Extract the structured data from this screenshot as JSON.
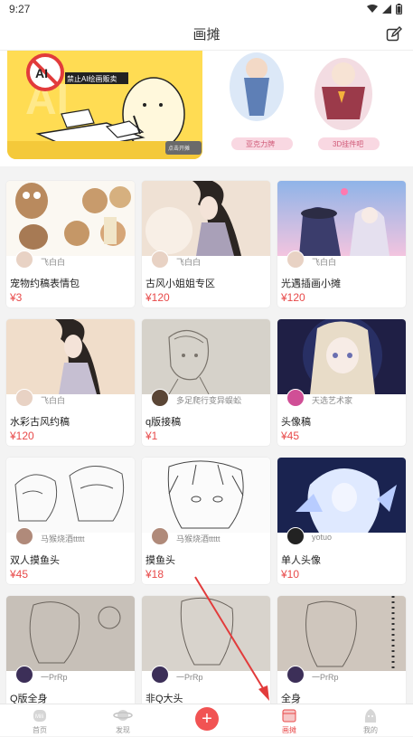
{
  "status_bar": {
    "time": "9:27"
  },
  "header": {
    "title": "画摊"
  },
  "banner": {
    "left": {
      "notice": "禁止AI绘画贩卖",
      "small_tag": "点击开摊"
    },
    "right": {
      "tag1": "亚克力牌",
      "tag2": "3D挂件吧"
    }
  },
  "cards": [
    {
      "title": "宠物约稿表情包",
      "price": "¥3",
      "author": "飞白白"
    },
    {
      "title": "古风小姐姐专区",
      "price": "¥120",
      "author": "飞白白"
    },
    {
      "title": "光遇插画小摊",
      "price": "¥120",
      "author": "飞白白"
    },
    {
      "title": "水彩古风约稿",
      "price": "¥120",
      "author": "飞白白"
    },
    {
      "title": "q版接稿",
      "price": "¥1",
      "author": "多足爬行变异蜈蚣"
    },
    {
      "title": "头像稿",
      "price": "¥45",
      "author": "天选艺术家"
    },
    {
      "title": "双人摸鱼头",
      "price": "¥45",
      "author": "马猴烧酒ttttt"
    },
    {
      "title": "摸鱼头",
      "price": "¥18",
      "author": "马猴烧酒ttttt"
    },
    {
      "title": "单人头像",
      "price": "¥10",
      "author": "yotuo"
    },
    {
      "title": "Q版全身",
      "price": "",
      "author": "一PrRp"
    },
    {
      "title": "非Q大头",
      "price": "",
      "author": "一PrRp"
    },
    {
      "title": "全身",
      "price": "",
      "author": "一PrRp"
    }
  ],
  "bottom_nav": {
    "home": "首页",
    "discover": "发现",
    "add": "+",
    "stall": "画摊",
    "mine": "我的"
  },
  "colors": {
    "accent": "#e84a4a",
    "banner_yellow": "#ffdc53"
  }
}
